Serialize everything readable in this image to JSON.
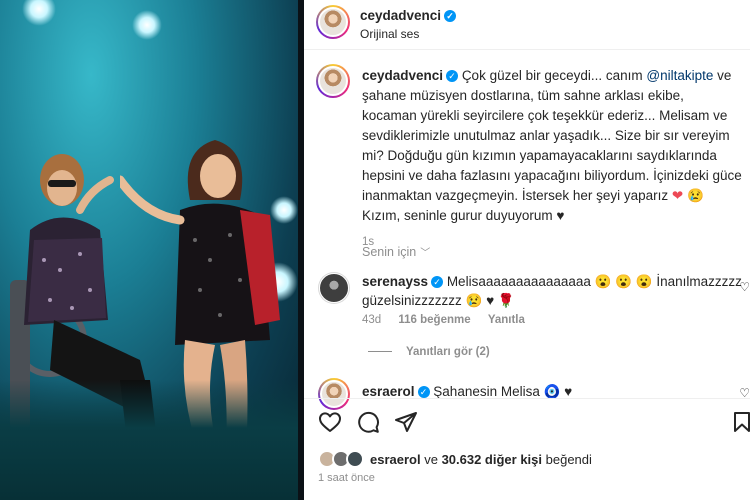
{
  "post": {
    "username": "ceydadvenci",
    "audio": "Orijinal ses"
  },
  "caption": {
    "username": "ceydadvenci",
    "part1": "Çok güzel bir geceydi... canım ",
    "mention": "@niltakipte",
    "part2": " ve şahane müzisyen dostlarına, tüm sahne arklası ekibe, kocaman yürekli seyircilere çok teşekkür ederiz... Melisam ve sevdiklerimizle unutulmaz anlar yaşadık... Size bir sır vereyim mi? Doğduğu gün kızımın yapamayacaklarını saydıklarında hepsini ve daha fazlasını yapacağını biliyordum. İçinizdeki güce inanmaktan vazgeçmeyin. İstersek her şeyi yaparız ",
    "emoji1": "❤",
    "emoji2": "😢",
    "part3": " Kızım, seninle gurur duyuyorum ",
    "emoji3": "♥",
    "time": "1s"
  },
  "for_you": "Senin için",
  "comments": [
    {
      "username": "serenayss",
      "text": " Melisaaaaaaaaaaaaaaa 😮 😮 😮 İnanılmazzzzz güzelsinizzzzzzz 😢 ♥ 🌹",
      "age": "43d",
      "likes": "116 beğenme",
      "reply": "Yanıtla"
    },
    {
      "username": "esraerol",
      "text": " Şahanesin Melisa 🧿 ♥"
    }
  ],
  "view_replies": "Yanıtları gör (2)",
  "likes": {
    "user": "esraerol",
    "connector": " ve ",
    "count": "30.632 diğer kişi",
    "suffix": " beğendi"
  },
  "posted_time": "1 saat önce",
  "colors": {
    "link": "#00376b",
    "verified": "#0095f6",
    "muted": "#8e8e8e"
  }
}
